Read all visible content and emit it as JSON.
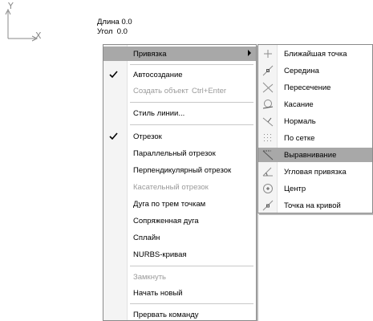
{
  "canvas": {
    "axis_y_label": "Y",
    "axis_x_label": "X",
    "readout_length": "Длина 0.0",
    "readout_angle": "Угол  0.0"
  },
  "main_menu": {
    "snap": "Привязка",
    "autocreate": "Автосоздание",
    "create_object": "Создать объект",
    "create_object_shortcut": "Ctrl+Enter",
    "line_style": "Стиль линии...",
    "segment": "Отрезок",
    "parallel_segment": "Параллельный отрезок",
    "perpendicular_segment": "Перпендикулярный отрезок",
    "tangent_segment": "Касательный отрезок",
    "arc_three_points": "Дуга по трем точкам",
    "conjugate_arc": "Сопряженная дуга",
    "spline": "Сплайн",
    "nurbs_curve": "NURBS-кривая",
    "close": "Замкнуть",
    "start_new": "Начать новый",
    "abort_command": "Прервать команду"
  },
  "snap_menu": {
    "nearest_point": "Ближайшая точка",
    "middle": "Середина",
    "intersection": "Пересечение",
    "tangency": "Касание",
    "normal": "Нормаль",
    "by_grid": "По сетке",
    "alignment": "Выравнивание",
    "angle_snap": "Угловая привязка",
    "center": "Центр",
    "point_on_curve": "Точка на кривой"
  },
  "colors": {
    "highlight": "#a8a8a8",
    "disabled_text": "#9a9a9a",
    "icon_gray": "#8c8c8c"
  }
}
